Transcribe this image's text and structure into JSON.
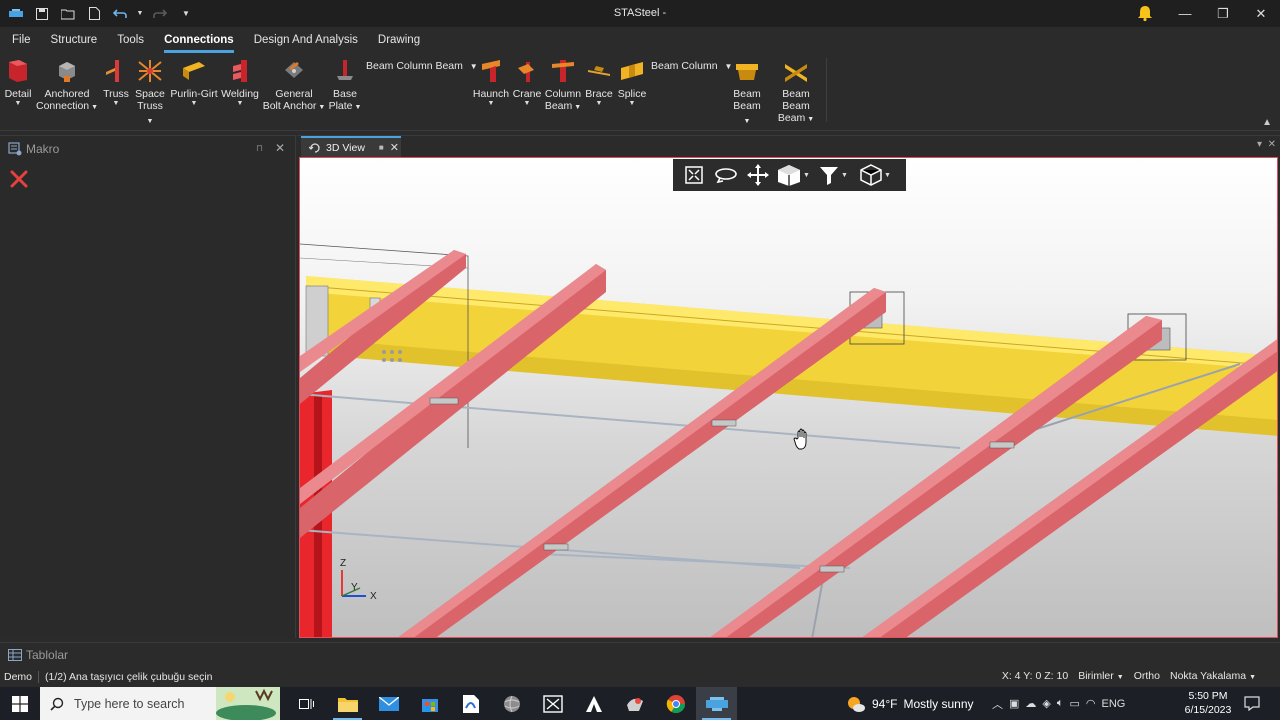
{
  "window": {
    "title": "STASteel -"
  },
  "menu": {
    "tabs": [
      "File",
      "Structure",
      "Tools",
      "Connections",
      "Design And Analysis",
      "Drawing"
    ],
    "active": "Connections"
  },
  "ribbon": {
    "detail": "Detail",
    "anchored_1": "Anchored",
    "anchored_2": "Connection",
    "truss": "Truss",
    "space_truss_1": "Space",
    "space_truss_2": "Truss",
    "purlin_girt": "Purlin-Girt",
    "welding": "Welding",
    "general_1": "General",
    "general_2": "Bolt Anchor",
    "base_plate_1": "Base",
    "base_plate_2": "Plate",
    "beam_column_beam": "Beam Column Beam",
    "haunch": "Haunch",
    "crane": "Crane",
    "column_beam_1": "Column",
    "column_beam_2": "Beam",
    "brace": "Brace",
    "splice": "Splice",
    "beam_column": "Beam Column",
    "beam_beam_1": "Beam",
    "beam_beam_2": "Beam",
    "beam_beam_beam_1": "Beam Beam",
    "beam_beam_beam_2": "Beam"
  },
  "left_panel": {
    "title": "Makro"
  },
  "view": {
    "tab_label": "3D View"
  },
  "axes": {
    "z": "Z",
    "y": "Y",
    "x": "X"
  },
  "bottom_panel": {
    "title": "Tablolar"
  },
  "status": {
    "mode": "Demo",
    "prompt": "(1/2) Ana taşıyıcı çelik çubuğu seçin",
    "coords": "X: 4 Y: 0 Z: 10",
    "units": "Birimler",
    "ortho": "Ortho",
    "snap": "Nokta Yakalama"
  },
  "taskbar": {
    "search_placeholder": "Type here to search",
    "weather_temp": "94°F",
    "weather_text": "Mostly sunny",
    "language": "ENG",
    "time": "5:50 PM",
    "date": "6/15/2023"
  },
  "colors": {
    "accent": "#4aa3df",
    "beam_red": "#d9646a",
    "beam_yellow": "#ffe24a",
    "column_red": "#e8262b",
    "viewport_border": "#e0505a"
  }
}
